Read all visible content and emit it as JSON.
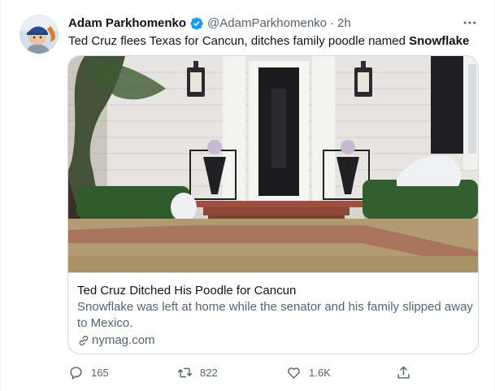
{
  "tweet": {
    "display_name": "Adam Parkhomenko",
    "handle": "@AdamParkhomenko",
    "separator": "·",
    "time": "2h",
    "text_main": "Ted Cruz flees Texas for Cancun, ditches family poodle named ",
    "text_bold": "Snowflake"
  },
  "card": {
    "title": "Ted Cruz Ditched His Poodle for Cancun",
    "description": "Snowflake was left at home while the senator and his family slipped away to Mexico.",
    "domain": "nymag.com"
  },
  "actions": {
    "reply_count": "165",
    "retweet_count": "822",
    "like_count": "1.6K"
  },
  "icons": {
    "verified": "verified-badge-icon",
    "more": "more-dots-icon",
    "link": "link-icon",
    "reply": "reply-icon",
    "retweet": "retweet-icon",
    "like": "heart-icon",
    "share": "share-icon"
  },
  "colors": {
    "verified": "#1d9bf0",
    "secondary_text": "#536471",
    "primary_text": "#0f1419",
    "border": "#cfd9de"
  }
}
